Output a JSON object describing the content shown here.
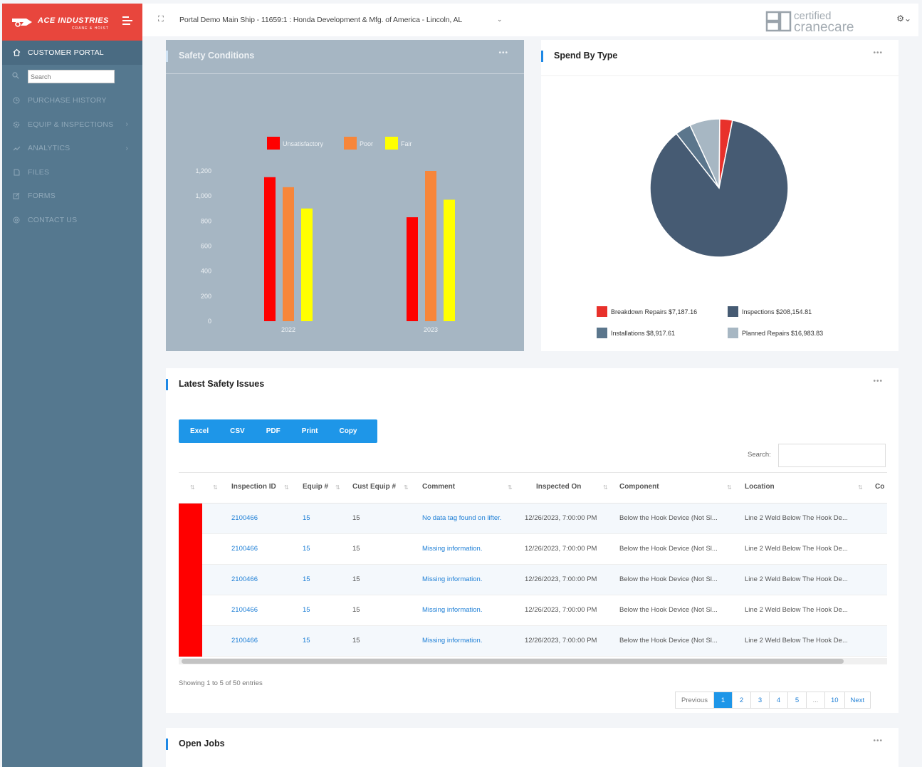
{
  "brand": {
    "name": "ACE INDUSTRIES",
    "sub": "CRANE & HOIST"
  },
  "sidebar": {
    "active_item": "CUSTOMER PORTAL",
    "search_placeholder": "Search",
    "items": [
      {
        "label": "PURCHASE HISTORY",
        "icon": "clock-icon"
      },
      {
        "label": "EQUIP & INSPECTIONS",
        "icon": "gear-icon",
        "has_chevron": true
      },
      {
        "label": "ANALYTICS",
        "icon": "chart-icon",
        "has_chevron": true
      },
      {
        "label": "FILES",
        "icon": "file-icon"
      },
      {
        "label": "FORMS",
        "icon": "form-icon"
      },
      {
        "label": "CONTACT US",
        "icon": "contact-icon"
      }
    ]
  },
  "topbar": {
    "location": "Portal Demo Main Ship - 11659:1 : Honda Development & Mfg. of America - Lincoln, AL",
    "logo_top": "certified",
    "logo_bottom": "cranecare"
  },
  "safety_conditions": {
    "title": "Safety Conditions",
    "chart_data": {
      "type": "bar",
      "categories": [
        "2022",
        "2023"
      ],
      "series": [
        {
          "name": "Unsatisfactory",
          "values": [
            1150,
            830
          ],
          "color": "#ff0000"
        },
        {
          "name": "Poor",
          "values": [
            1070,
            1200
          ],
          "color": "#f7863a"
        },
        {
          "name": "Fair",
          "values": [
            900,
            970
          ],
          "color": "#ffff00"
        }
      ],
      "yticks": [
        "0",
        "200",
        "400",
        "600",
        "800",
        "1,000",
        "1,200"
      ],
      "ylim": [
        0,
        1200
      ],
      "legend": "top"
    }
  },
  "spend_by_type": {
    "title": "Spend By Type",
    "chart_data": {
      "type": "pie",
      "slices": [
        {
          "name": "Breakdown Repairs",
          "label": "$7,187.16",
          "value": 7187.16,
          "color": "#e8312b"
        },
        {
          "name": "Inspections",
          "label": "$208,154.81",
          "value": 208154.81,
          "color": "#465b73"
        },
        {
          "name": "Installations",
          "label": "$8,917.61",
          "value": 8917.61,
          "color": "#5b768c"
        },
        {
          "name": "Planned Repairs",
          "label": "$16,983.83",
          "value": 16983.83,
          "color": "#a7b7c3"
        }
      ],
      "legend": "bottom"
    }
  },
  "latest_safety_issues": {
    "title": "Latest Safety Issues",
    "export_buttons": [
      "Excel",
      "CSV",
      "PDF",
      "Print",
      "Copy"
    ],
    "search_label": "Search:",
    "columns": [
      "Inspection ID",
      "Equip #",
      "Cust Equip #",
      "Comment",
      "Inspected On",
      "Component",
      "Location",
      "Co"
    ],
    "rows": [
      {
        "id": "2100466",
        "equip": "15",
        "cust_equip": "15",
        "comment": "No data tag found on lifter.",
        "inspected_on": "12/26/2023, 7:00:00 PM",
        "component": "Below the Hook Device (Not Sl...",
        "location": "Line 2 Weld Below The Hook De..."
      },
      {
        "id": "2100466",
        "equip": "15",
        "cust_equip": "15",
        "comment": "Missing information.",
        "inspected_on": "12/26/2023, 7:00:00 PM",
        "component": "Below the Hook Device (Not Sl...",
        "location": "Line 2 Weld Below The Hook De..."
      },
      {
        "id": "2100466",
        "equip": "15",
        "cust_equip": "15",
        "comment": "Missing information.",
        "inspected_on": "12/26/2023, 7:00:00 PM",
        "component": "Below the Hook Device (Not Sl...",
        "location": "Line 2 Weld Below The Hook De..."
      },
      {
        "id": "2100466",
        "equip": "15",
        "cust_equip": "15",
        "comment": "Missing information.",
        "inspected_on": "12/26/2023, 7:00:00 PM",
        "component": "Below the Hook Device (Not Sl...",
        "location": "Line 2 Weld Below The Hook De..."
      },
      {
        "id": "2100466",
        "equip": "15",
        "cust_equip": "15",
        "comment": "Missing information.",
        "inspected_on": "12/26/2023, 7:00:00 PM",
        "component": "Below the Hook Device (Not Sl...",
        "location": "Line 2 Weld Below The Hook De..."
      }
    ],
    "showing": "Showing 1 to 5 of 50 entries",
    "pager": {
      "previous": "Previous",
      "pages": [
        "1",
        "2",
        "3",
        "4",
        "5",
        "...",
        "10"
      ],
      "current": "1",
      "next": "Next"
    }
  },
  "open_jobs": {
    "title": "Open Jobs"
  }
}
